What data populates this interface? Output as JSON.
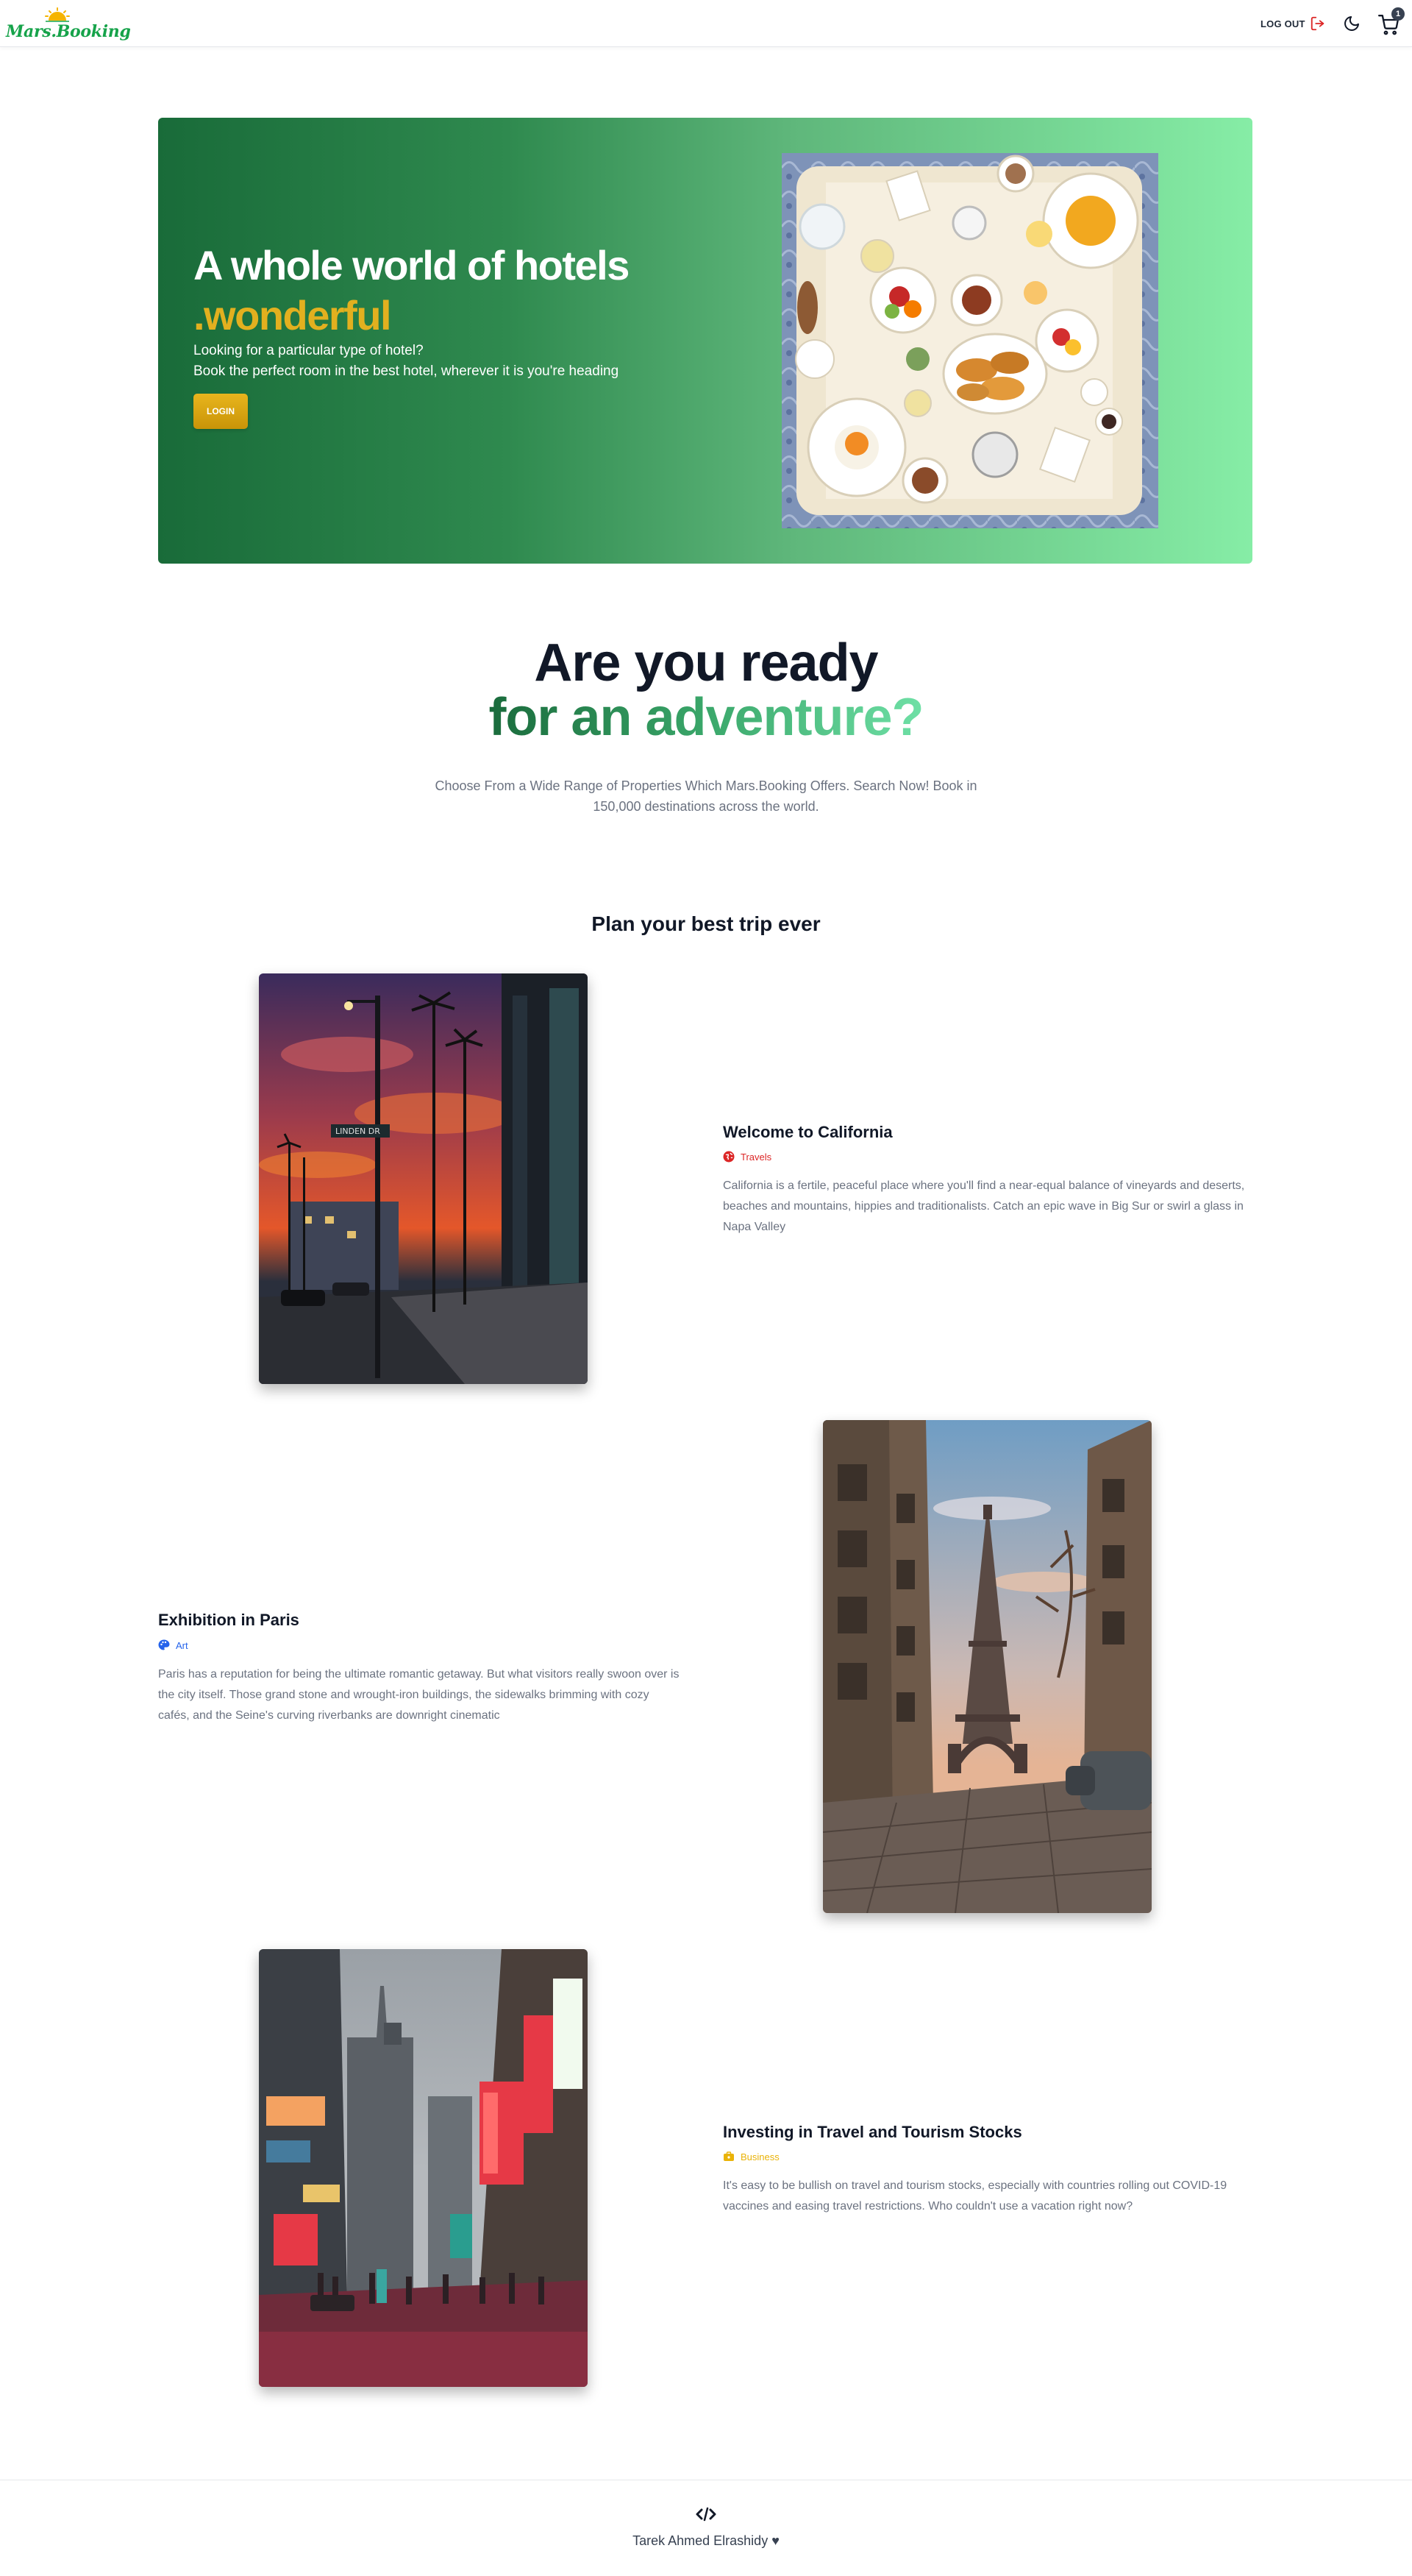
{
  "header": {
    "brand": "Mars.Booking",
    "logout_label": "LOG OUT",
    "cart_count": "1",
    "icons": {
      "logo": "sun-icon",
      "logout": "logout-icon",
      "theme": "moon-icon",
      "cart": "cart-icon"
    }
  },
  "hero": {
    "title": "A whole world of hotels",
    "subtitle": ".wonderful",
    "text_line1": "Looking for a particular type of hotel?",
    "text_line2": "Book the perfect room in the best hotel, wherever it is you're heading",
    "login_label": "LOGIN",
    "colors": {
      "gradient_start": "#196b39",
      "gradient_end": "#86eda6",
      "accent": "#e2b01f"
    }
  },
  "adventure": {
    "line1": "Are you ready",
    "line2": "for an adventure?",
    "description": "Choose From a Wide Range of Properties Which Mars.Booking Offers. Search Now! Book in 150,000 destinations across the world."
  },
  "plan": {
    "title": "Plan your best trip ever",
    "items": [
      {
        "title": "Welcome to California",
        "category": "Travels",
        "category_icon": "globe-icon",
        "category_color": "#dc2626",
        "description": "California is a fertile, peaceful place where you'll find a near-equal balance of vineyards and deserts, beaches and mountains, hippies and traditionalists. Catch an epic wave in Big Sur or swirl a glass in Napa Valley"
      },
      {
        "title": "Exhibition in Paris",
        "category": "Art",
        "category_icon": "palette-icon",
        "category_color": "#2563eb",
        "description": "Paris has a reputation for being the ultimate romantic getaway. But what visitors really swoon over is the city itself. Those grand stone and wrought-iron buildings, the sidewalks brimming with cozy cafés, and the Seine's curving riverbanks are downright cinematic"
      },
      {
        "title": "Investing in Travel and Tourism Stocks",
        "category": "Business",
        "category_icon": "briefcase-icon",
        "category_color": "#eab308",
        "description": "It's easy to be bullish on travel and tourism stocks, especially with countries rolling out COVID-19 vaccines and easing travel restrictions. Who couldn't use a vacation right now?"
      }
    ]
  },
  "footer": {
    "code_icon": "code-icon",
    "credit": "Tarek Ahmed Elrashidy ♥"
  }
}
